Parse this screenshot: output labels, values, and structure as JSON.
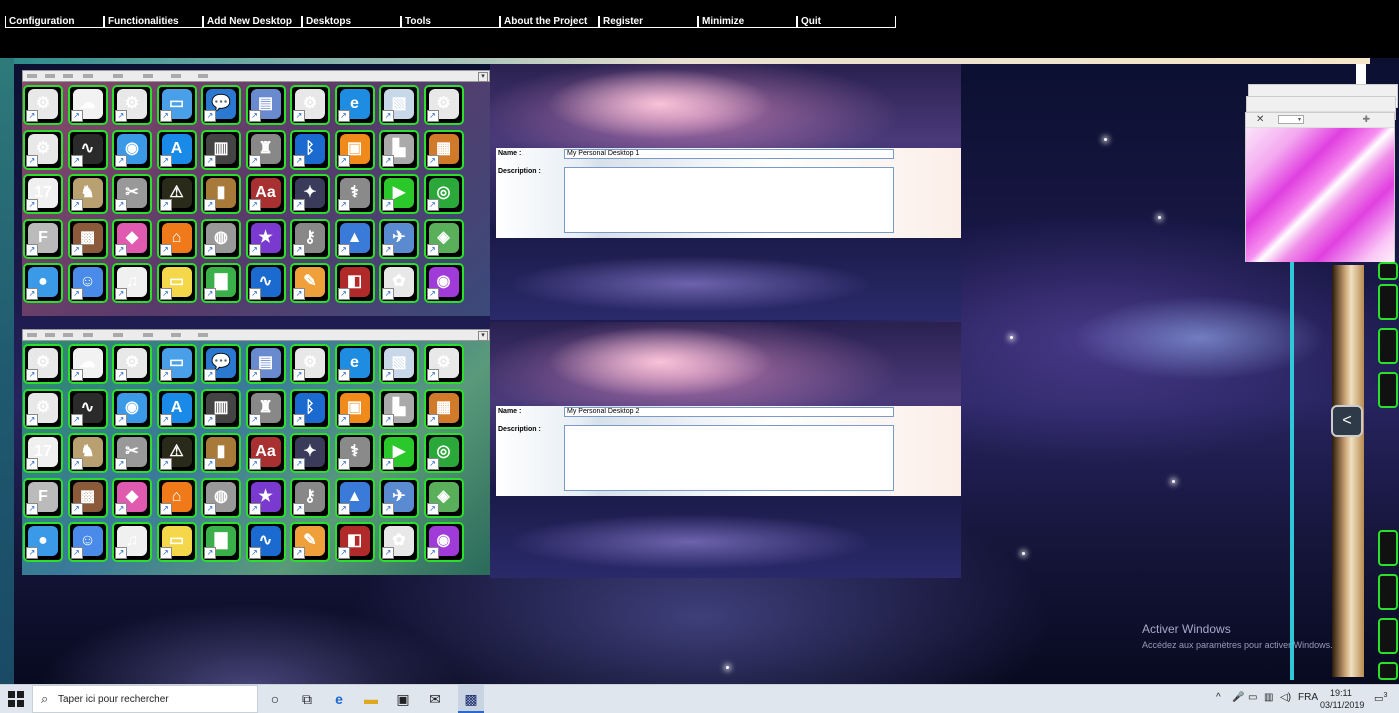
{
  "menu": [
    "Configuration",
    "Functionalities",
    "Add New Desktop",
    "Desktops",
    "Tools",
    "About the Project",
    "Register",
    "Minimize",
    "Quit"
  ],
  "launcher_icons": [
    {
      "name": "generic-file-icon",
      "glyph": "⚙",
      "bg": "#e8e8e8"
    },
    {
      "name": "cloud-icon",
      "glyph": "☁",
      "bg": "#f2f2f2"
    },
    {
      "name": "generic-file-icon",
      "glyph": "⚙",
      "bg": "#e8e8e8"
    },
    {
      "name": "monitor-icon",
      "glyph": "▭",
      "bg": "#4aa0e8"
    },
    {
      "name": "chat-screen-icon",
      "glyph": "💬",
      "bg": "#2a78d0"
    },
    {
      "name": "computers-icon",
      "glyph": "▤",
      "bg": "#6a8ad0"
    },
    {
      "name": "generic-file-icon",
      "glyph": "⚙",
      "bg": "#e8e8e8"
    },
    {
      "name": "internet-explorer-icon",
      "glyph": "e",
      "bg": "#1e8ce0"
    },
    {
      "name": "preview-icon",
      "glyph": "▧",
      "bg": "#c8d8e8"
    },
    {
      "name": "generic-file-icon",
      "glyph": "⚙",
      "bg": "#e8e8e8"
    },
    {
      "name": "generic-file-icon",
      "glyph": "⚙",
      "bg": "#e8e8e8"
    },
    {
      "name": "activity-monitor-icon",
      "glyph": "∿",
      "bg": "#2a2a2a"
    },
    {
      "name": "wifi-icon",
      "glyph": "◉",
      "bg": "#3a9ae8"
    },
    {
      "name": "app-store-icon",
      "glyph": "A",
      "bg": "#1a8ae8"
    },
    {
      "name": "piano-icon",
      "glyph": "▥",
      "bg": "#444"
    },
    {
      "name": "automator-icon",
      "glyph": "♜",
      "bg": "#888"
    },
    {
      "name": "bluetooth-icon",
      "glyph": "ᛒ",
      "bg": "#1a6ad0"
    },
    {
      "name": "ibooks-icon",
      "glyph": "▣",
      "bg": "#f08a1a"
    },
    {
      "name": "boot-camp-icon",
      "glyph": "▙",
      "bg": "#aaa"
    },
    {
      "name": "calculator-icon",
      "glyph": "▦",
      "bg": "#d07a2a"
    },
    {
      "name": "calendar-icon",
      "glyph": "17",
      "bg": "#f0f0f0"
    },
    {
      "name": "chess-icon",
      "glyph": "♞",
      "bg": "#b8a070"
    },
    {
      "name": "utilities-icon",
      "glyph": "✂",
      "bg": "#999"
    },
    {
      "name": "console-icon",
      "glyph": "⚠",
      "bg": "#2a2a1a"
    },
    {
      "name": "contacts-icon",
      "glyph": "▮",
      "bg": "#a87a3a"
    },
    {
      "name": "dictionary-icon",
      "glyph": "Aa",
      "bg": "#a83030"
    },
    {
      "name": "compass-icon",
      "glyph": "✦",
      "bg": "#3a3a5a"
    },
    {
      "name": "disk-utility-icon",
      "glyph": "⚕",
      "bg": "#8a8a8a"
    },
    {
      "name": "facetime-icon",
      "glyph": "▶",
      "bg": "#2ac82a"
    },
    {
      "name": "dvd-player-icon",
      "glyph": "◎",
      "bg": "#2aa83a"
    },
    {
      "name": "font-book-icon",
      "glyph": "F",
      "bg": "#bbb"
    },
    {
      "name": "box-icon",
      "glyph": "▩",
      "bg": "#8a5a3a"
    },
    {
      "name": "color-prism-icon",
      "glyph": "◆",
      "bg": "#e05ab0"
    },
    {
      "name": "home-icon",
      "glyph": "⌂",
      "bg": "#f07a1a"
    },
    {
      "name": "speaker-icon",
      "glyph": "◍",
      "bg": "#999"
    },
    {
      "name": "imovie-icon",
      "glyph": "★",
      "bg": "#7a3ad0"
    },
    {
      "name": "keychain-icon",
      "glyph": "⚷",
      "bg": "#888"
    },
    {
      "name": "keynote-icon",
      "glyph": "▲",
      "bg": "#3a7ad8"
    },
    {
      "name": "preview-image-icon",
      "glyph": "✈",
      "bg": "#5a8ad0"
    },
    {
      "name": "maps-icon",
      "glyph": "◈",
      "bg": "#5ab05a"
    },
    {
      "name": "messages-icon",
      "glyph": "●",
      "bg": "#3a9ae8"
    },
    {
      "name": "finder-icon",
      "glyph": "☺",
      "bg": "#4a8ae8"
    },
    {
      "name": "itunes-icon",
      "glyph": "♫",
      "bg": "#f0f0f0"
    },
    {
      "name": "notes-icon",
      "glyph": "▭",
      "bg": "#f4d84a"
    },
    {
      "name": "numbers-icon",
      "glyph": "▇",
      "bg": "#3ab04a"
    },
    {
      "name": "openoffice-icon",
      "glyph": "∿",
      "bg": "#1a6ad0"
    },
    {
      "name": "pages-icon",
      "glyph": "✎",
      "bg": "#f0a03a"
    },
    {
      "name": "photo-booth-icon",
      "glyph": "◧",
      "bg": "#b02a2a"
    },
    {
      "name": "photos-icon",
      "glyph": "✿",
      "bg": "#e8e8e8"
    },
    {
      "name": "podcasts-icon",
      "glyph": "◉",
      "bg": "#a03ad8"
    }
  ],
  "desktops": [
    {
      "name_label": "Name :",
      "name_value": "My Personal Desktop 1",
      "description_label": "Description :",
      "description_value": ""
    },
    {
      "name_label": "Name :",
      "name_value": "My Personal Desktop 2",
      "description_label": "Description :",
      "description_value": ""
    }
  ],
  "right_pane": {
    "collapse_label": "<"
  },
  "watermark": {
    "title": "Activer Windows",
    "subtitle": "Accédez aux paramètres pour activer Windows."
  },
  "taskbar": {
    "search_placeholder": "Taper ici pour rechercher",
    "language": "FRA",
    "time": "19:11",
    "date": "03/11/2019",
    "notification_count": "3"
  }
}
